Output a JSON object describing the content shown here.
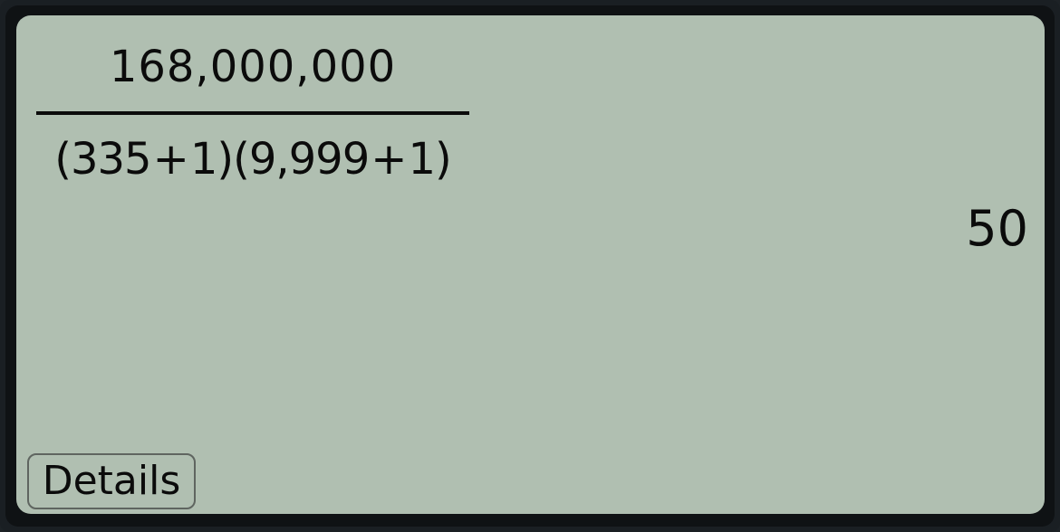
{
  "calculation": {
    "numerator": "168,000,000",
    "denominator": {
      "open_1": "(",
      "a": "335",
      "op_1": "+",
      "b": "1",
      "close_1": ")",
      "open_2": "(",
      "c": "9,999",
      "op_2": "+",
      "d": "1",
      "close_2": ")"
    },
    "result": "50"
  },
  "actions": {
    "details_label": "Details"
  },
  "colors": {
    "screen_background": "#b0bfb1",
    "text": "#0b0b0b",
    "bezel": "#1a1f23"
  }
}
